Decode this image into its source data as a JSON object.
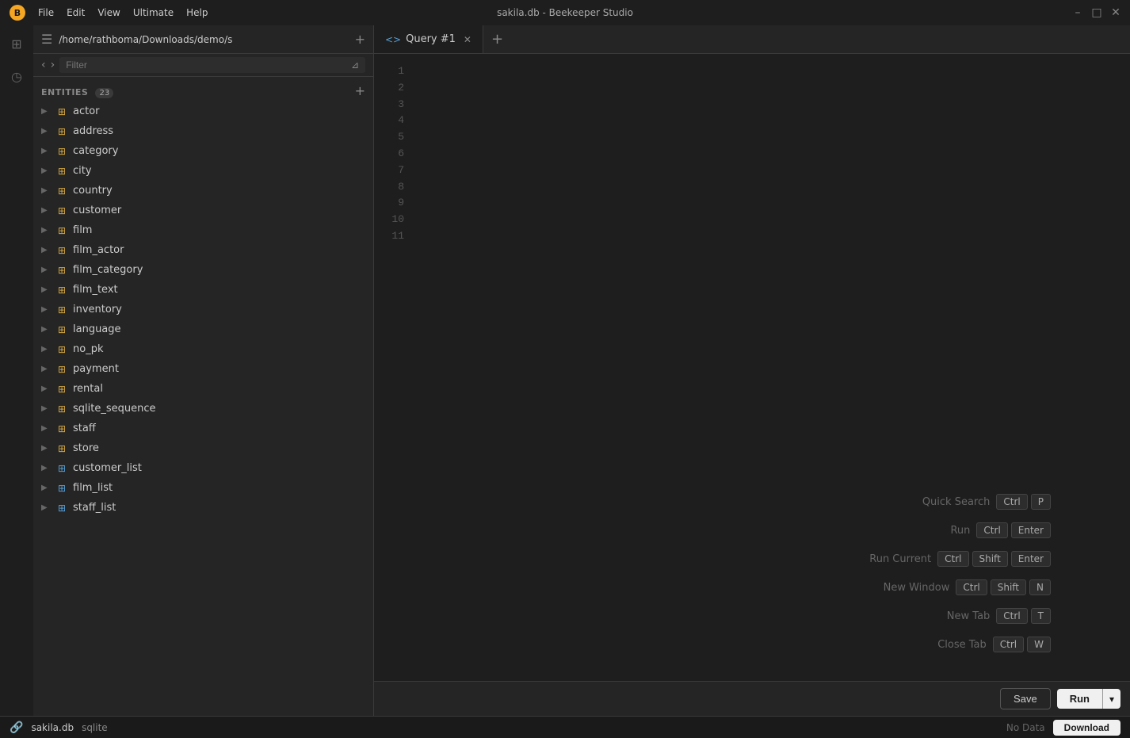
{
  "app": {
    "title": "sakila.db - Beekeeper Studio",
    "logo": "B"
  },
  "titlebar": {
    "menu_items": [
      "File",
      "Edit",
      "View",
      "Ultimate",
      "Help"
    ],
    "minimize": "–",
    "maximize": "□",
    "close": "✕"
  },
  "sidebar": {
    "path": "/home/rathboma/Downloads/demo/s",
    "filter_placeholder": "Filter",
    "entities_label": "ENTITIES",
    "entities_count": "23",
    "entities": [
      {
        "name": "actor",
        "type": "table"
      },
      {
        "name": "address",
        "type": "table"
      },
      {
        "name": "category",
        "type": "table"
      },
      {
        "name": "city",
        "type": "table"
      },
      {
        "name": "country",
        "type": "table"
      },
      {
        "name": "customer",
        "type": "table"
      },
      {
        "name": "film",
        "type": "table"
      },
      {
        "name": "film_actor",
        "type": "table"
      },
      {
        "name": "film_category",
        "type": "table"
      },
      {
        "name": "film_text",
        "type": "table"
      },
      {
        "name": "inventory",
        "type": "table"
      },
      {
        "name": "language",
        "type": "table"
      },
      {
        "name": "no_pk",
        "type": "table"
      },
      {
        "name": "payment",
        "type": "table"
      },
      {
        "name": "rental",
        "type": "table"
      },
      {
        "name": "sqlite_sequence",
        "type": "table"
      },
      {
        "name": "staff",
        "type": "table"
      },
      {
        "name": "store",
        "type": "table"
      },
      {
        "name": "customer_list",
        "type": "view"
      },
      {
        "name": "film_list",
        "type": "view"
      },
      {
        "name": "staff_list",
        "type": "view"
      }
    ]
  },
  "tabs": [
    {
      "label": "Query #1",
      "active": true
    }
  ],
  "editor": {
    "line_numbers": [
      "1",
      "2",
      "3",
      "4",
      "5",
      "6",
      "7",
      "8",
      "9",
      "10",
      "11"
    ]
  },
  "shortcuts": [
    {
      "label": "Quick Search",
      "keys": [
        "Ctrl",
        "P"
      ]
    },
    {
      "label": "Run",
      "keys": [
        "Ctrl",
        "Enter"
      ]
    },
    {
      "label": "Run Current",
      "keys": [
        "Ctrl",
        "Shift",
        "Enter"
      ]
    },
    {
      "label": "New Window",
      "keys": [
        "Ctrl",
        "Shift",
        "N"
      ]
    },
    {
      "label": "New Tab",
      "keys": [
        "Ctrl",
        "T"
      ]
    },
    {
      "label": "Close Tab",
      "keys": [
        "Ctrl",
        "W"
      ]
    }
  ],
  "toolbar": {
    "save_label": "Save",
    "run_label": "Run"
  },
  "statusbar": {
    "db_name": "sakila.db",
    "dialect": "sqlite",
    "no_data": "No Data",
    "download_label": "Download"
  }
}
